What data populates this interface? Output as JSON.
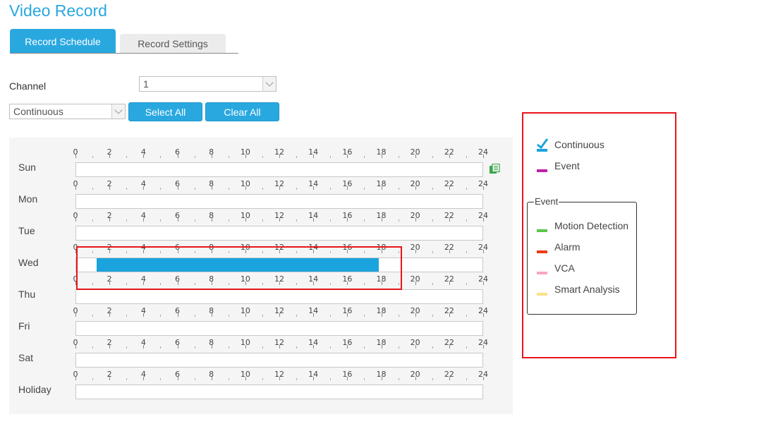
{
  "page": {
    "title": "Video Record"
  },
  "tabs": [
    {
      "label": "Record Schedule",
      "active": true
    },
    {
      "label": "Record Settings",
      "active": false
    }
  ],
  "controls": {
    "channel_label": "Channel",
    "channel_value": "1",
    "record_type_value": "Continuous",
    "select_all_label": "Select All",
    "clear_all_label": "Clear All"
  },
  "schedule": {
    "hour_labels": [
      "0",
      "2",
      "4",
      "6",
      "8",
      "10",
      "12",
      "14",
      "16",
      "18",
      "20",
      "22",
      "24"
    ],
    "days": [
      {
        "name": "Sun",
        "fills": []
      },
      {
        "name": "Mon",
        "fills": []
      },
      {
        "name": "Tue",
        "fills": []
      },
      {
        "name": "Wed",
        "fills": [
          {
            "start_hour": 1.2,
            "end_hour": 17.8,
            "type": "Continuous"
          }
        ]
      },
      {
        "name": "Thu",
        "fills": []
      },
      {
        "name": "Fri",
        "fills": []
      },
      {
        "name": "Sat",
        "fills": []
      },
      {
        "name": "Holiday",
        "fills": []
      }
    ],
    "copy_icon": "copy-icon"
  },
  "legend": {
    "items": [
      {
        "label": "Continuous",
        "color": "#1aa3dd",
        "icon": "check-icon"
      },
      {
        "label": "Event",
        "color": "#c01fa5"
      }
    ],
    "event_group": {
      "caption": "Event",
      "items": [
        {
          "label": "Motion Detection",
          "color": "#5ac649"
        },
        {
          "label": "Alarm",
          "color": "#ee3b12"
        },
        {
          "label": "VCA",
          "color": "#f7a6c4"
        },
        {
          "label": "Smart Analysis",
          "color": "#fbe187"
        }
      ]
    }
  },
  "colors": {
    "accent": "#29a8e0",
    "highlight": "#e8151b"
  }
}
